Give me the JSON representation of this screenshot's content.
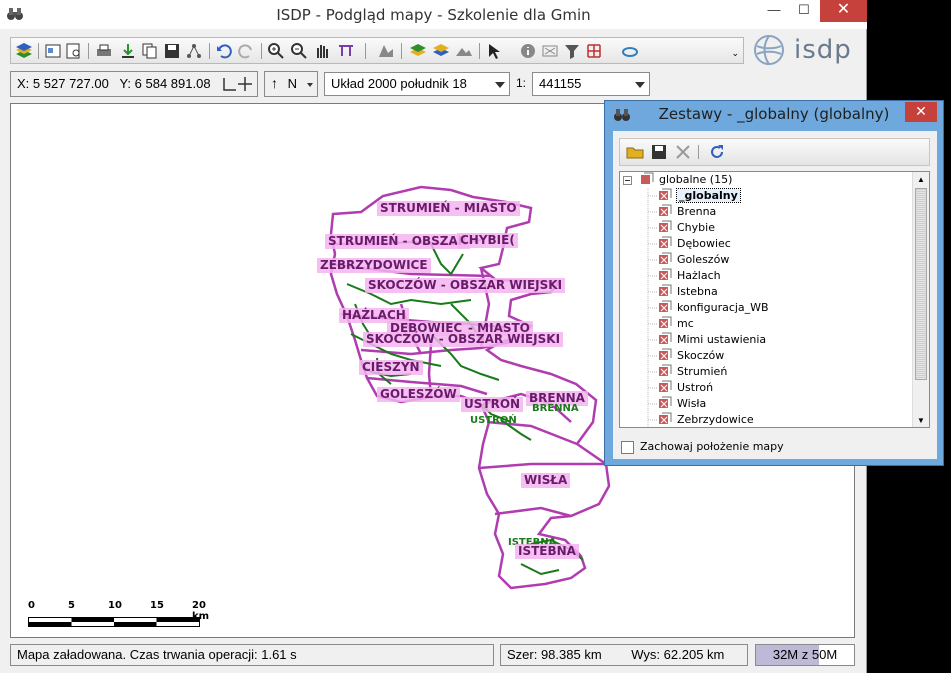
{
  "window": {
    "title": "ISDP - Podgląd mapy - Szkolenie dla Gmin",
    "minimize": "—",
    "maximize": "☐",
    "close": "✕"
  },
  "logo": {
    "text": "isdp"
  },
  "coords": {
    "x_label": "X:",
    "x_value": "5 527 727.00",
    "y_label": "Y:",
    "y_value": "6 584 891.08",
    "north": "N",
    "crs": "Układ 2000 południk 18",
    "scale_label": "1:",
    "scale_value": "441155"
  },
  "map": {
    "labels": [
      {
        "text": "STRUMIEŃ - MIASTO",
        "type": "pink"
      },
      {
        "text": "STRUMIEŃ - OBSZAR",
        "type": "pink"
      },
      {
        "text": "CHYBIE(",
        "type": "pink"
      },
      {
        "text": "ZEBRZYDOWICE",
        "type": "pink"
      },
      {
        "text": "SKOCZÓW - OBSZAR WIEJSKI",
        "type": "pink"
      },
      {
        "text": "HAŻLACH",
        "type": "pink"
      },
      {
        "text": "DĘBOWIEC",
        "type": "pink"
      },
      {
        "text": "- MIASTO",
        "type": "pink"
      },
      {
        "text": "SKOCZÓW - OBSZAR WIEJSKI",
        "type": "pink"
      },
      {
        "text": "CIESZYN",
        "type": "pink"
      },
      {
        "text": "GOLESZÓW",
        "type": "pink"
      },
      {
        "text": "USTROŃ",
        "type": "pink"
      },
      {
        "text": "BRENNA",
        "type": "pink"
      },
      {
        "text": "USTROŃ",
        "type": "green"
      },
      {
        "text": "BRENNA",
        "type": "green"
      },
      {
        "text": "WISŁA",
        "type": "pink"
      },
      {
        "text": "ISTEBNA",
        "type": "green"
      },
      {
        "text": "ISTEBNA",
        "type": "pink"
      }
    ],
    "scalebar": {
      "ticks": [
        "0",
        "5",
        "10",
        "15",
        "20 km"
      ]
    },
    "colors": {
      "boundary": "#b03cb0",
      "roads": "#1a7a1a"
    }
  },
  "status": {
    "message": "Mapa załadowana. Czas trwania operacji: 1.61 s",
    "width": "Szer: 98.385 km",
    "height": "Wys: 62.205 km",
    "memory": "32M z 50M",
    "memory_fraction": 0.64
  },
  "dialog": {
    "title": "Zestawy - _globalny (globalny)",
    "close": "✕",
    "tree": {
      "root": "globalne (15)",
      "items": [
        "_globalny",
        "Brenna",
        "Chybie",
        "Dębowiec",
        "Goleszów",
        "Hażlach",
        "Istebna",
        "konfiguracja_WB",
        "mc",
        "Mimi ustawienia",
        "Skoczów",
        "Strumień",
        "Ustroń",
        "Wisła",
        "Zebrzydowice"
      ],
      "selected": "_globalny"
    },
    "keep_position": "Zachowaj położenie mapy"
  }
}
